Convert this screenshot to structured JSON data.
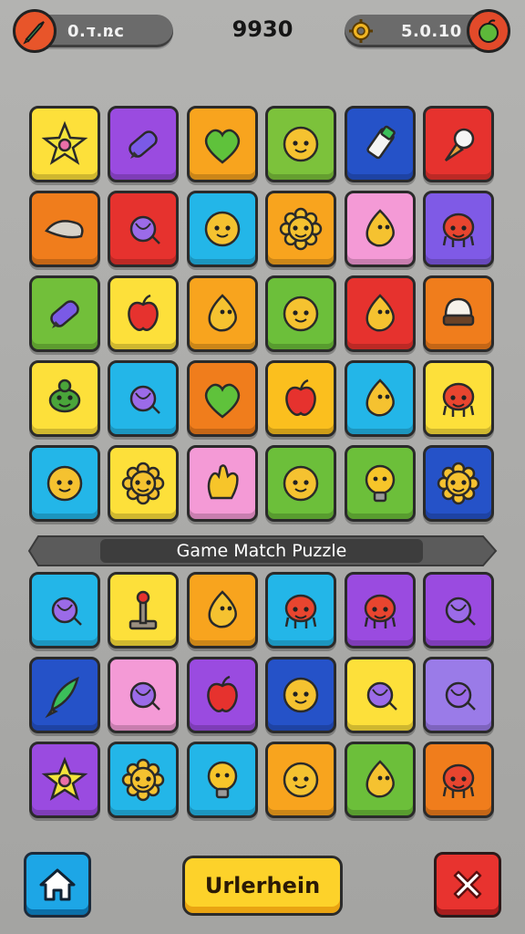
{
  "top_bar": {
    "left_value": "ד.0.ռc",
    "score": "9930",
    "right_value": "5.0.10",
    "left_icon": "rocket-icon",
    "gear_icon": "gear-icon",
    "right_icon": "apple-icon"
  },
  "banner": {
    "title": "Game Match Puzzle"
  },
  "grid_top": [
    [
      {
        "c": "#fde03a",
        "i": "star"
      },
      {
        "c": "#9a4be0",
        "i": "crayon"
      },
      {
        "c": "#f8a41e",
        "i": "heart"
      },
      {
        "c": "#7cc23b",
        "i": "face"
      },
      {
        "c": "#2552c8",
        "i": "marker"
      },
      {
        "c": "#e6322e",
        "i": "cone"
      }
    ],
    [
      {
        "c": "#f07d1c",
        "i": "fish"
      },
      {
        "c": "#e6322e",
        "i": "candy"
      },
      {
        "c": "#23b6e8",
        "i": "face"
      },
      {
        "c": "#f8a41e",
        "i": "flower"
      },
      {
        "c": "#f49ad6",
        "i": "drop"
      },
      {
        "c": "#7f5ae6",
        "i": "octo"
      }
    ],
    [
      {
        "c": "#72bf3a",
        "i": "crayon"
      },
      {
        "c": "#fde03a",
        "i": "apple"
      },
      {
        "c": "#f8a41e",
        "i": "drop"
      },
      {
        "c": "#6cbf3a",
        "i": "face"
      },
      {
        "c": "#e6322e",
        "i": "drop"
      },
      {
        "c": "#f07d1c",
        "i": "cup"
      }
    ],
    [
      {
        "c": "#fde03a",
        "i": "turtle"
      },
      {
        "c": "#23b6e8",
        "i": "candy"
      },
      {
        "c": "#f07d1c",
        "i": "heart"
      },
      {
        "c": "#fbbf1e",
        "i": "apple"
      },
      {
        "c": "#23b6e8",
        "i": "drop"
      },
      {
        "c": "#fde03a",
        "i": "octo"
      }
    ],
    [
      {
        "c": "#23b6e8",
        "i": "face"
      },
      {
        "c": "#fde03a",
        "i": "flower"
      },
      {
        "c": "#f49ad6",
        "i": "hand"
      },
      {
        "c": "#6cbf3a",
        "i": "face"
      },
      {
        "c": "#6cbf3a",
        "i": "bulb"
      },
      {
        "c": "#2552c8",
        "i": "flower"
      }
    ]
  ],
  "grid_bottom": [
    [
      {
        "c": "#23b6e8",
        "i": "candy"
      },
      {
        "c": "#fde03a",
        "i": "joystick"
      },
      {
        "c": "#f8a41e",
        "i": "drop"
      },
      {
        "c": "#23b6e8",
        "i": "octo"
      },
      {
        "c": "#9a4be0",
        "i": "octo"
      },
      {
        "c": "#9a4be0",
        "i": "candy"
      }
    ],
    [
      {
        "c": "#2552c8",
        "i": "rocket"
      },
      {
        "c": "#f49ad6",
        "i": "candy"
      },
      {
        "c": "#9a4be0",
        "i": "apple"
      },
      {
        "c": "#2552c8",
        "i": "face"
      },
      {
        "c": "#fde03a",
        "i": "candy"
      },
      {
        "c": "#9a7be8",
        "i": "candy"
      }
    ],
    [
      {
        "c": "#9a4be0",
        "i": "star"
      },
      {
        "c": "#23b6e8",
        "i": "flower"
      },
      {
        "c": "#23b6e8",
        "i": "bulb"
      },
      {
        "c": "#f8a41e",
        "i": "face"
      },
      {
        "c": "#6cbf3a",
        "i": "drop"
      },
      {
        "c": "#f07d1c",
        "i": "octo"
      }
    ]
  ],
  "colors": {
    "background": "#a9a9a7",
    "banner": "#3d3d3d",
    "home": "#1da6e6",
    "play": "#fdd22a",
    "close": "#e8332f"
  },
  "buttons": {
    "home_icon": "home-icon",
    "main_label": "Urlerhein",
    "close_icon": "close-icon"
  }
}
